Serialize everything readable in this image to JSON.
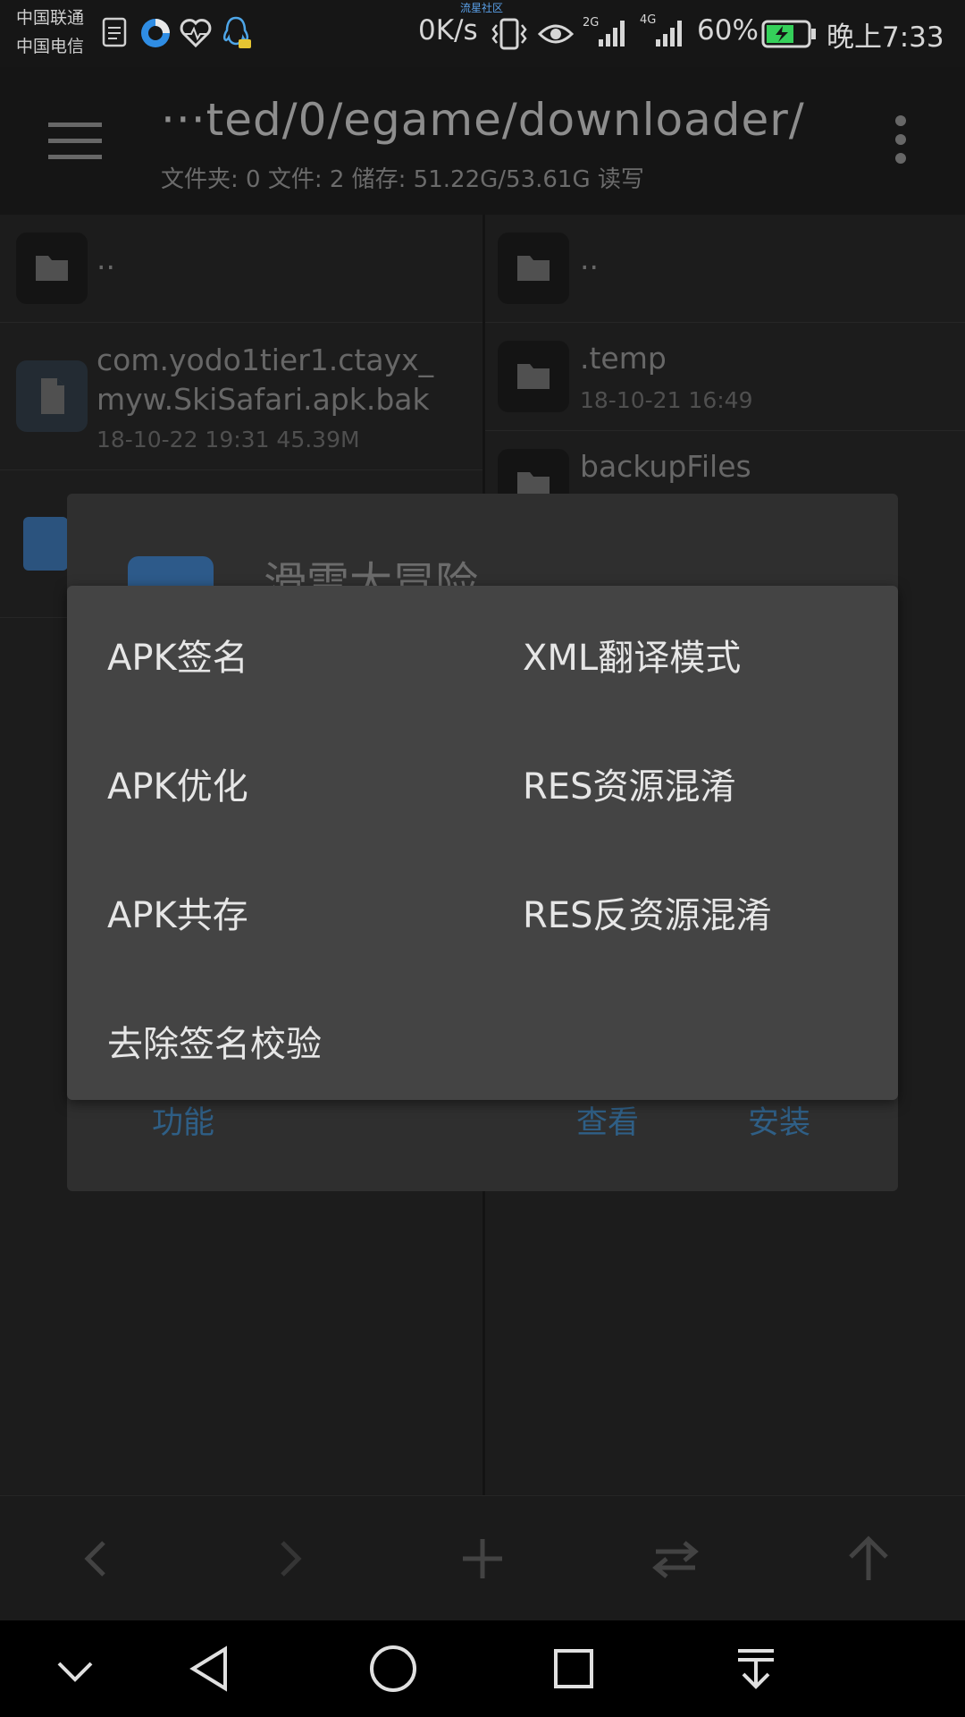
{
  "status_bar": {
    "carrier1": "中国联通",
    "carrier2": "中国电信",
    "community_label": "流星社区",
    "speed": "0K/s",
    "net_2g": "2G",
    "net_4g": "4G",
    "battery": "60%",
    "time": "晚上7:33"
  },
  "toolbar": {
    "path": "···ted/0/egame/downloader/",
    "info": "文件夹: 0   文件: 2   储存: 51.22G/53.61G   读写"
  },
  "left_pane": {
    "parent": "..",
    "file_name_line1": "com.yodo1tier1.ctayx_",
    "file_name_line2": "myw.SkiSafari.apk.bak",
    "file_meta": "18-10-22 19:31  45.39M"
  },
  "right_pane": {
    "parent": "..",
    "items": [
      {
        "name": ".temp",
        "meta": "18-10-21 16:49"
      },
      {
        "name": "backupFiles",
        "meta": ""
      }
    ]
  },
  "back_dialog": {
    "title": "滑雪大冒险",
    "btn_function": "功能",
    "btn_view": "查看",
    "btn_install": "安装",
    "colors": {
      "button": "#2f5f86"
    }
  },
  "menu": {
    "items": [
      {
        "label": "APK签名"
      },
      {
        "label": "XML翻译模式"
      },
      {
        "label": "APK优化"
      },
      {
        "label": "RES资源混淆"
      },
      {
        "label": "APK共存"
      },
      {
        "label": "RES反资源混淆"
      },
      {
        "label": "去除签名校验"
      }
    ]
  },
  "bottom_bar": {
    "icons": [
      "back-arrow-icon",
      "forward-arrow-icon",
      "add-icon",
      "swap-icon",
      "up-arrow-icon"
    ]
  },
  "nav_bar": {
    "icons": [
      "chevron-down-icon",
      "back-triangle-icon",
      "home-circle-icon",
      "recents-square-icon",
      "notification-pull-icon"
    ]
  }
}
